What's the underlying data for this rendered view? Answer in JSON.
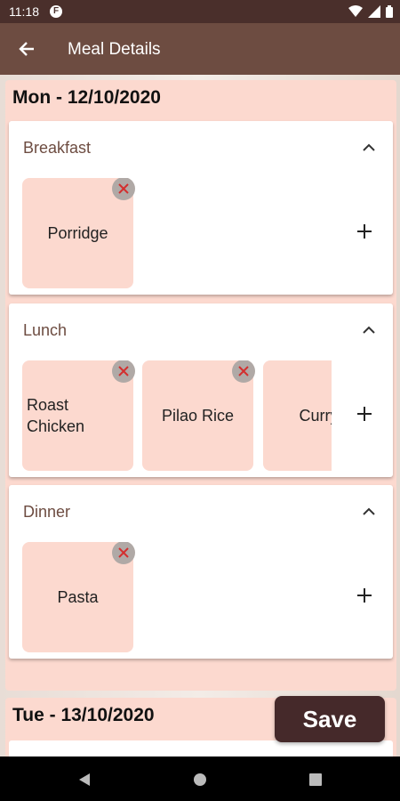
{
  "status_bar": {
    "time": "11:18",
    "app_icon_letter": "F"
  },
  "app_bar": {
    "title": "Meal Details"
  },
  "days": [
    {
      "day": "Mon",
      "separator": " - ",
      "date": "12/10/2020",
      "meals": [
        {
          "title": "Breakfast",
          "items": [
            "Porridge"
          ]
        },
        {
          "title": "Lunch",
          "items": [
            "Roast Chicken",
            "Pilao Rice",
            "Curry"
          ]
        },
        {
          "title": "Dinner",
          "items": [
            "Pasta"
          ]
        }
      ]
    },
    {
      "day": "Tue",
      "separator": " - ",
      "date": "13/10/2020"
    }
  ],
  "save_label": "Save",
  "colors": {
    "app_bar": "#6d4c41",
    "status_bar": "#4a2f2b",
    "card_tint": "#fcd9cf",
    "save_button": "#45292a",
    "remove_icon": "#d32f2f"
  },
  "icons": {
    "back": "arrow-left-icon",
    "collapse": "chevron-up-icon",
    "add": "plus-icon",
    "remove": "close-icon"
  }
}
